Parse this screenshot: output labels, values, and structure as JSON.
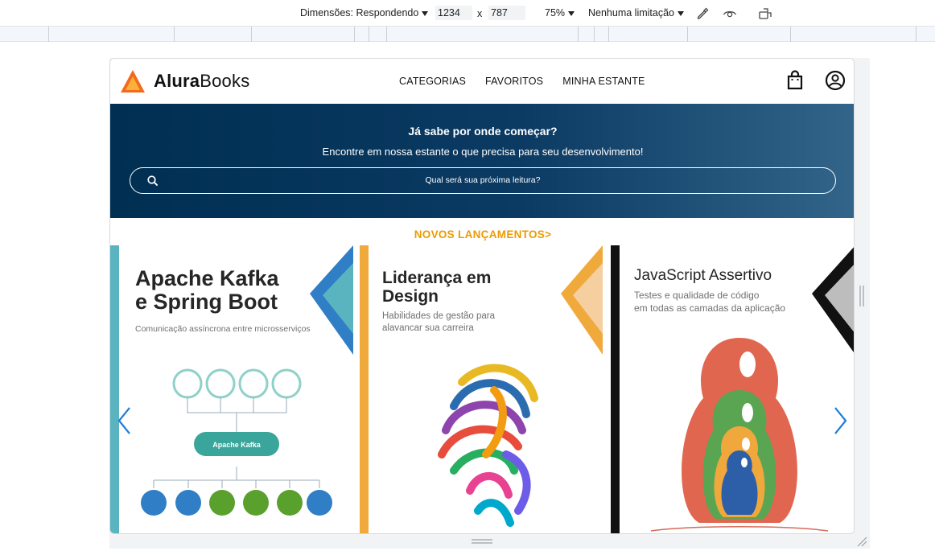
{
  "devtools": {
    "dimensions_label": "Dimensões: Respondendo",
    "width": "1234",
    "times": "x",
    "height": "787",
    "zoom": "75%",
    "throttle": "Nenhuma limitação"
  },
  "site": {
    "logo_bold": "Alura",
    "logo_rest": "Books",
    "nav": [
      "CATEGORIAS",
      "FAVORITOS",
      "MINHA ESTANTE"
    ]
  },
  "banner": {
    "title": "Já sabe por onde começar?",
    "subtitle": "Encontre em nossa estante o que precisa para seu desenvolvimento!",
    "search_placeholder": "Qual será sua próxima leitura?"
  },
  "section": {
    "title": "NOVOS LANÇAMENTOS>"
  },
  "books": [
    {
      "title_line1": "Apache Kafka",
      "title_line2": "e Spring Boot",
      "subtitle": "Comunicação assíncrona entre microsserviços",
      "diagram_center": "Apache Kafka",
      "accent": "#5ab4c0"
    },
    {
      "title_line1": "Liderança em",
      "title_line2": "Design",
      "subtitle_line1": "Habilidades de gestão para",
      "subtitle_line2": "alavancar sua carreira",
      "accent": "#f0aa3c"
    },
    {
      "title_line1": "JavaScript Assertivo",
      "subtitle_line1": "Testes e qualidade de código",
      "subtitle_line2": "em todas as camadas da aplicação",
      "accent": "#111111"
    }
  ],
  "colors": {
    "banner_dark": "#002f52",
    "section_title": "#eb9b00",
    "logo_orange": "#f26b1d",
    "carousel_arrow": "#1e7ed6"
  }
}
